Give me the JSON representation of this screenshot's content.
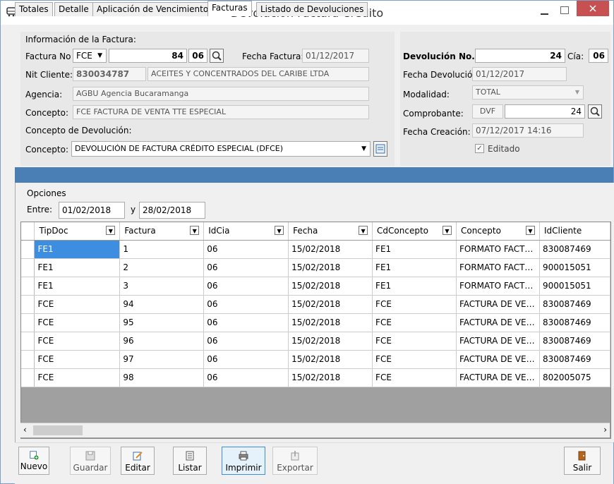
{
  "window": {
    "title": "Devolución Factura Crédito"
  },
  "factura_info": {
    "section_label": "Información de la Factura:",
    "factura_no_label": "Factura No",
    "doc_type": "FCE",
    "factura_number": "84",
    "factura_cia": "06",
    "fecha_factura_label": "Fecha Factura:",
    "fecha_factura": "01/12/2017",
    "nit_label": "Nit Cliente:",
    "nit": "830034787",
    "cliente_name": "ACEITES Y CONCENTRADOS DEL CARIBE  LTDA",
    "agencia_label": "Agencia:",
    "agencia": "AGBU Agencia Bucaramanga",
    "concepto_label": "Concepto:",
    "concepto": "FCE FACTURA DE VENTA TTE ESPECIAL",
    "concepto_dev_section": "Concepto de Devolución:",
    "concepto_dev_label": "Concepto:",
    "concepto_dev": "DEVOLUCIÓN DE FACTURA CRÉDITO ESPECIAL (DFCE)"
  },
  "devolucion": {
    "no_label": "Devolución No.",
    "no_value": "24",
    "cia_label": "Cía:",
    "cia_value": "06",
    "fecha_dev_label": "Fecha Devolución",
    "fecha_dev": "01/12/2017",
    "modalidad_label": "Modalidad:",
    "modalidad": "TOTAL",
    "comprobante_label": "Comprobante:",
    "comprobante_tipo": "DVF",
    "comprobante_num": "24",
    "fecha_creacion_label": "Fecha Creación:",
    "fecha_creacion": "07/12/2017 14:16",
    "editado_label": "Editado",
    "editado_checked": true
  },
  "tabs": [
    "Totales",
    "Detalle",
    "Aplicación de Vencimientos",
    "Facturas",
    "Listado de Devoluciones"
  ],
  "active_tab": "Facturas",
  "opciones": {
    "label": "Opciones",
    "entre_label": "Entre:",
    "desde": "01/02/2018",
    "y_label": "y",
    "hasta": "28/02/2018"
  },
  "grid": {
    "columns": [
      "TipDoc",
      "Factura",
      "IdCia",
      "Fecha",
      "CdConcepto",
      "Concepto",
      "IdCliente"
    ],
    "rows": [
      [
        "FE1",
        "1",
        "06",
        "15/02/2018",
        "FE1",
        "FORMATO FACT…",
        "830087469"
      ],
      [
        "FE1",
        "2",
        "06",
        "15/02/2018",
        "FE1",
        "FORMATO FACT…",
        "900015051"
      ],
      [
        "FE1",
        "3",
        "06",
        "15/02/2018",
        "FE1",
        "FORMATO FACT…",
        "900015051"
      ],
      [
        "FCE",
        "94",
        "06",
        "15/02/2018",
        "FCE",
        "FACTURA DE VE…",
        "830087469"
      ],
      [
        "FCE",
        "95",
        "06",
        "15/02/2018",
        "FCE",
        "FACTURA DE VE…",
        "830087469"
      ],
      [
        "FCE",
        "96",
        "06",
        "15/02/2018",
        "FCE",
        "FACTURA DE VE…",
        "830087469"
      ],
      [
        "FCE",
        "97",
        "06",
        "15/02/2018",
        "FCE",
        "FACTURA DE VE…",
        "830087469"
      ],
      [
        "FCE",
        "98",
        "06",
        "15/02/2018",
        "FCE",
        "FACTURA DE VE…",
        "802005075"
      ]
    ]
  },
  "toolbar": {
    "nuevo": "Nuevo",
    "guardar": "Guardar",
    "editar": "Editar",
    "listar": "Listar",
    "imprimir": "Imprimir",
    "exportar": "Exportar",
    "salir": "Salir"
  },
  "colors": {
    "accent": "#4a7fb5",
    "selection": "#3d8ee0",
    "close": "#c75050"
  }
}
